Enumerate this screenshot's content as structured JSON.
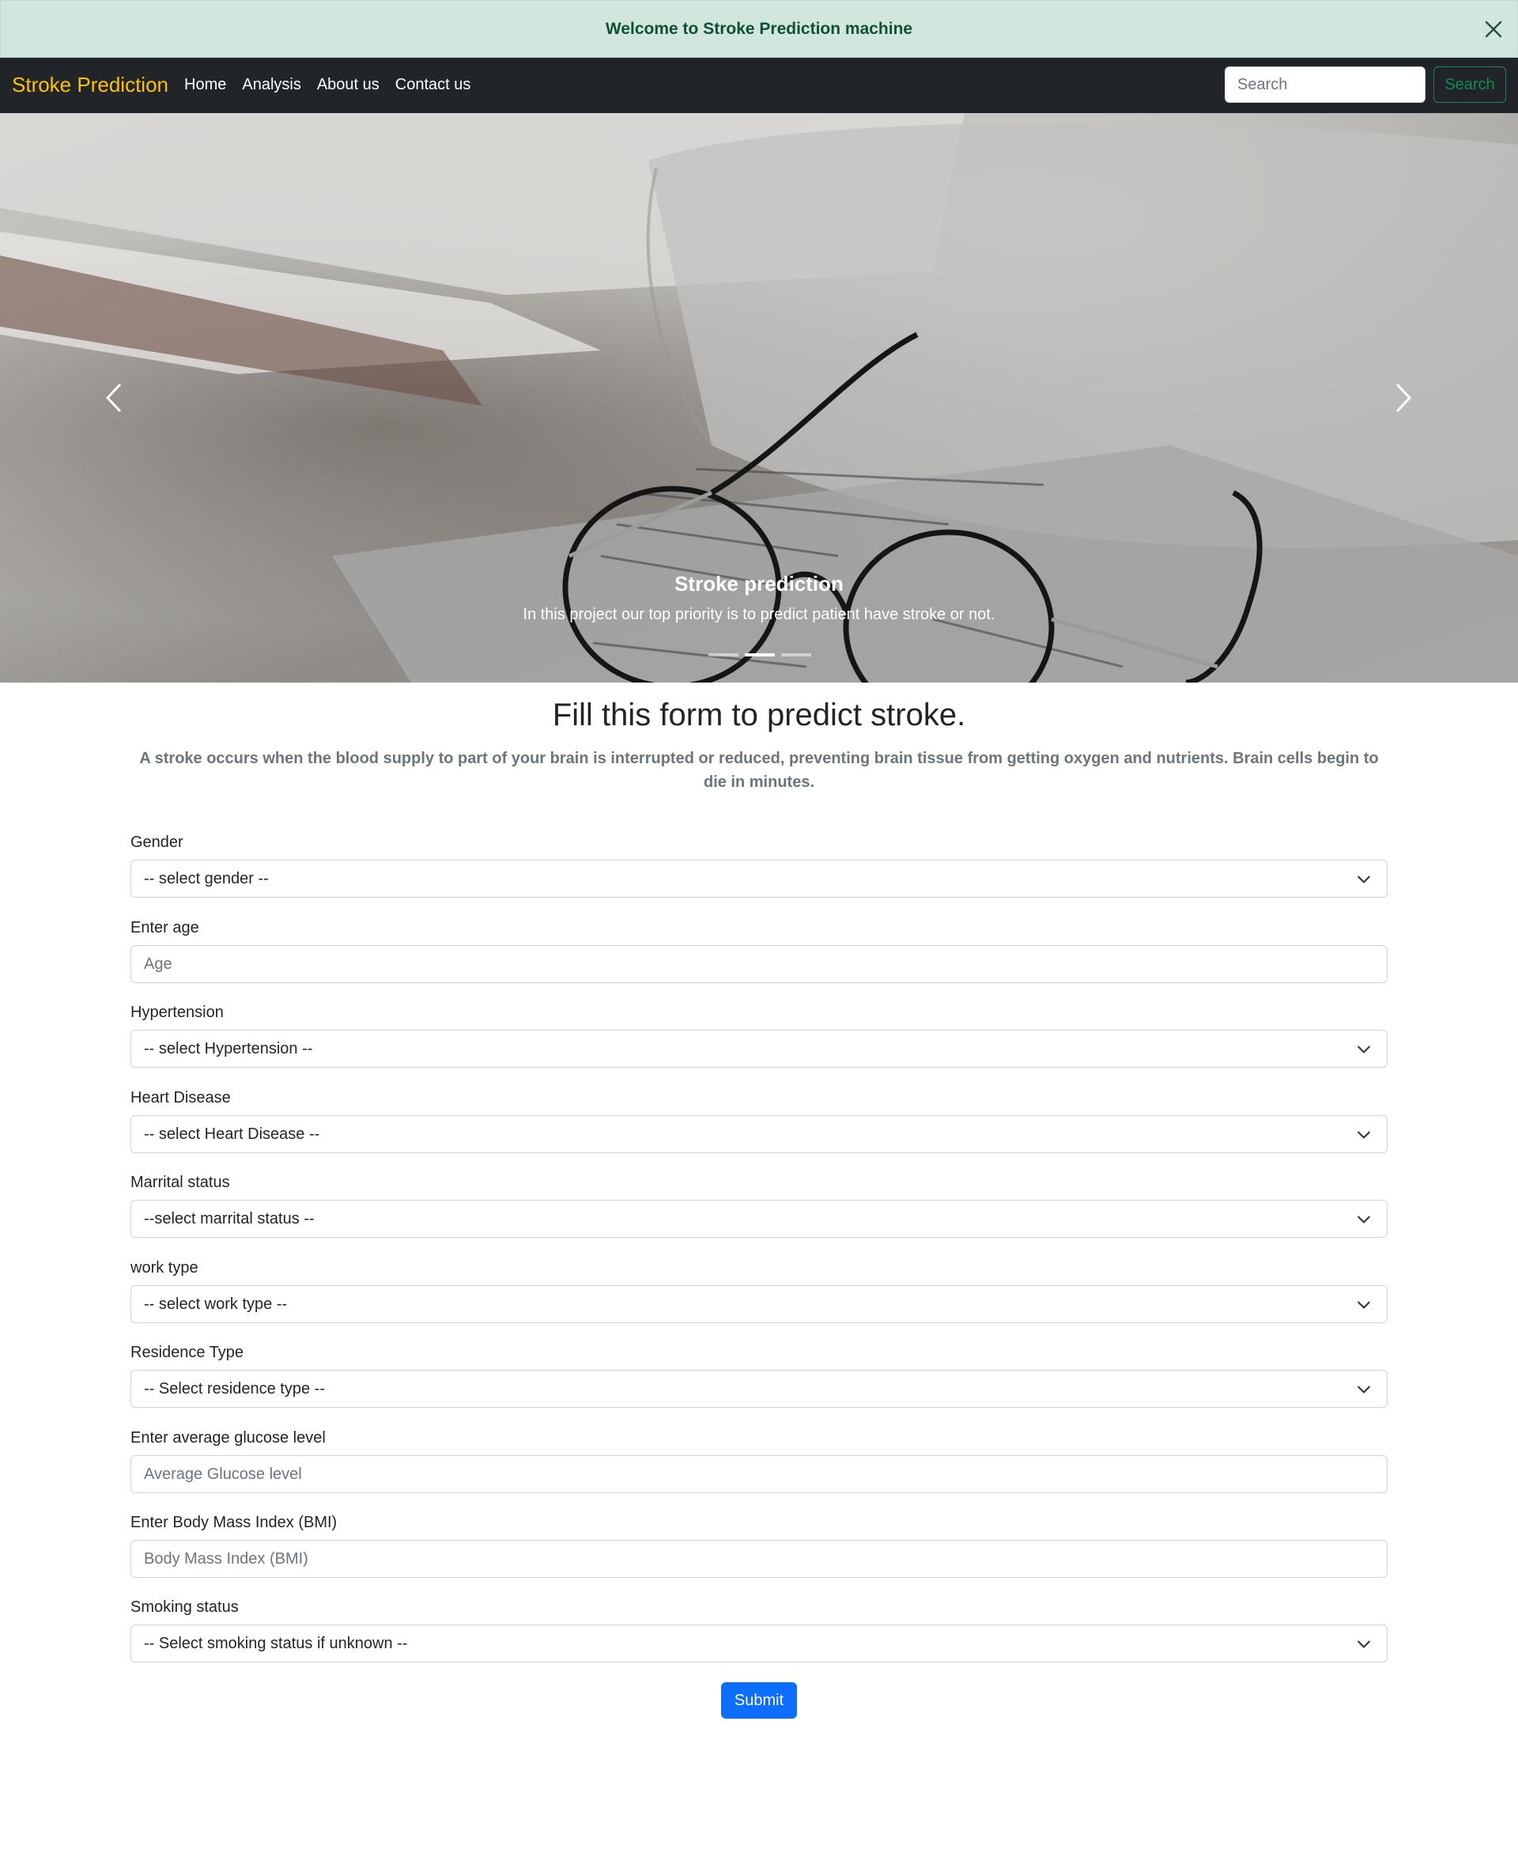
{
  "alert": {
    "text": "Welcome to Stroke Prediction machine",
    "close_icon": "close-icon"
  },
  "navbar": {
    "brand": "Stroke Prediction",
    "links": [
      "Home",
      "Analysis",
      "About us",
      "Contact us"
    ],
    "search_placeholder": "Search",
    "search_button": "Search"
  },
  "carousel": {
    "caption_title": "Stroke prediction",
    "caption_text": "In this project our top priority is to predict patient have stroke or not.",
    "slide_count": 3,
    "active_slide": 2,
    "prev_icon": "chevron-left-icon",
    "next_icon": "chevron-right-icon"
  },
  "form": {
    "title": "Fill this form to predict stroke.",
    "lead": "A stroke occurs when the blood supply to part of your brain is interrupted or reduced, preventing brain tissue from getting oxygen and nutrients. Brain cells begin to die in minutes.",
    "fields": [
      {
        "label": "Gender",
        "type": "select",
        "value": "-- select gender --"
      },
      {
        "label": "Enter age",
        "type": "input",
        "placeholder": "Age"
      },
      {
        "label": "Hypertension",
        "type": "select",
        "value": "-- select Hypertension --"
      },
      {
        "label": "Heart Disease",
        "type": "select",
        "value": "-- select Heart Disease --"
      },
      {
        "label": "Marrital status",
        "type": "select",
        "value": "--select marrital status --"
      },
      {
        "label": "work type",
        "type": "select",
        "value": "-- select work type --"
      },
      {
        "label": "Residence Type",
        "type": "select",
        "value": "-- Select residence type --"
      },
      {
        "label": "Enter average glucose level",
        "type": "input",
        "placeholder": "Average Glucose level"
      },
      {
        "label": "Enter Body Mass Index (BMI)",
        "type": "input",
        "placeholder": "Body Mass Index (BMI)"
      },
      {
        "label": "Smoking status",
        "type": "select",
        "value": "-- Select smoking status if unknown --"
      }
    ],
    "submit": "Submit"
  },
  "colors": {
    "alert_bg": "#d1e7dd",
    "alert_text": "#0f5132",
    "navbar_bg": "#212529",
    "brand": "#ffc107",
    "search_button": "#198754",
    "submit": "#0d6efd",
    "lead_text": "#6c757d"
  }
}
